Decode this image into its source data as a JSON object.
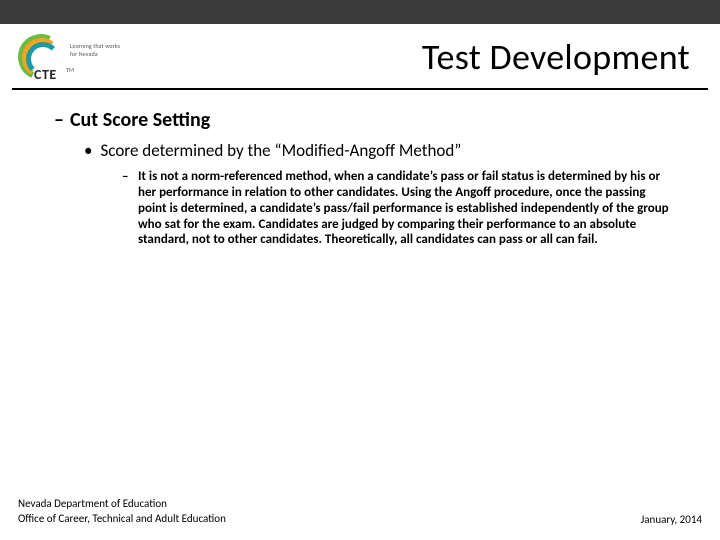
{
  "logo": {
    "tagline": "Learning that works for Nevada",
    "name": "CTE",
    "tm": "TM"
  },
  "title": "Test Development",
  "bullets": {
    "l1": "Cut Score Setting",
    "l2": "Score determined by the “Modified-Angoff Method”",
    "l3": "It is not a norm-referenced method, when a candidate’s pass or fail status is determined by his or her performance in relation to other candidates. Using the Angoff procedure, once the passing point is determined, a candidate’s pass/fail performance is established independently of the group who sat for the exam. Candidates are judged by comparing their performance to an absolute standard, not to other candidates. Theoretically, all candidates can pass or all can fail."
  },
  "footer": {
    "dept_line1": "Nevada Department of Education",
    "dept_line2": "Office of Career, Technical and Adult Education",
    "date": "January, 2014"
  }
}
